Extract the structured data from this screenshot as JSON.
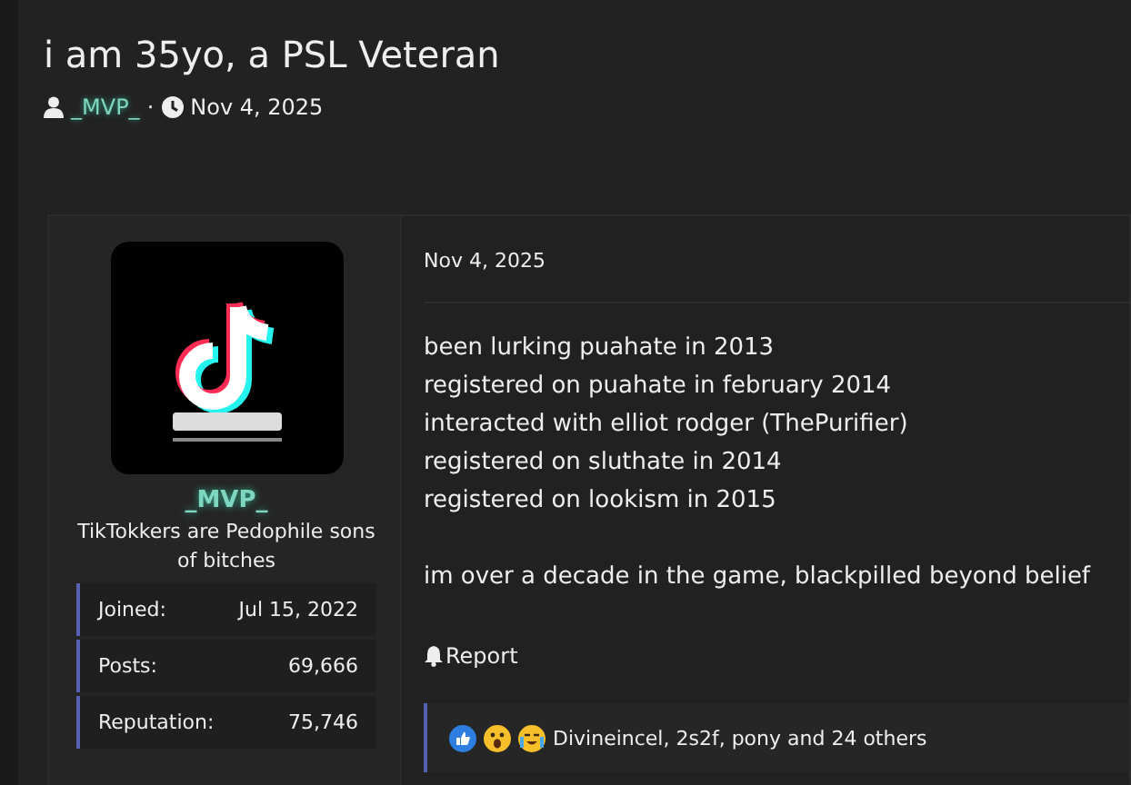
{
  "thread": {
    "title": "i am 35yo, a PSL Veteran",
    "author": "_MVP_",
    "separator": "·",
    "date": "Nov 4, 2025"
  },
  "user": {
    "name": "_MVP_",
    "user_title": "TikTokkers are Pedophile sons of bitches",
    "stats": [
      {
        "label": "Joined:",
        "value": "Jul 15, 2022"
      },
      {
        "label": "Posts:",
        "value": "69,666"
      },
      {
        "label": "Reputation:",
        "value": "75,746"
      }
    ]
  },
  "post": {
    "date": "Nov 4, 2025",
    "paragraphs": [
      [
        "been lurking puahate in 2013",
        "registered on puahate in february 2014",
        "interacted with elliot rodger (ThePurifier)",
        "registered on sluthate in 2014",
        "registered on lookism in 2015"
      ],
      [
        "im over a decade in the game, blackpilled beyond belief"
      ]
    ],
    "report": "Report",
    "reactions": [
      {
        "kind": "like"
      },
      {
        "kind": "wow"
      },
      {
        "kind": "cry"
      }
    ],
    "reaction_summary": "Divineincel, 2s2f, pony and 24 others"
  }
}
